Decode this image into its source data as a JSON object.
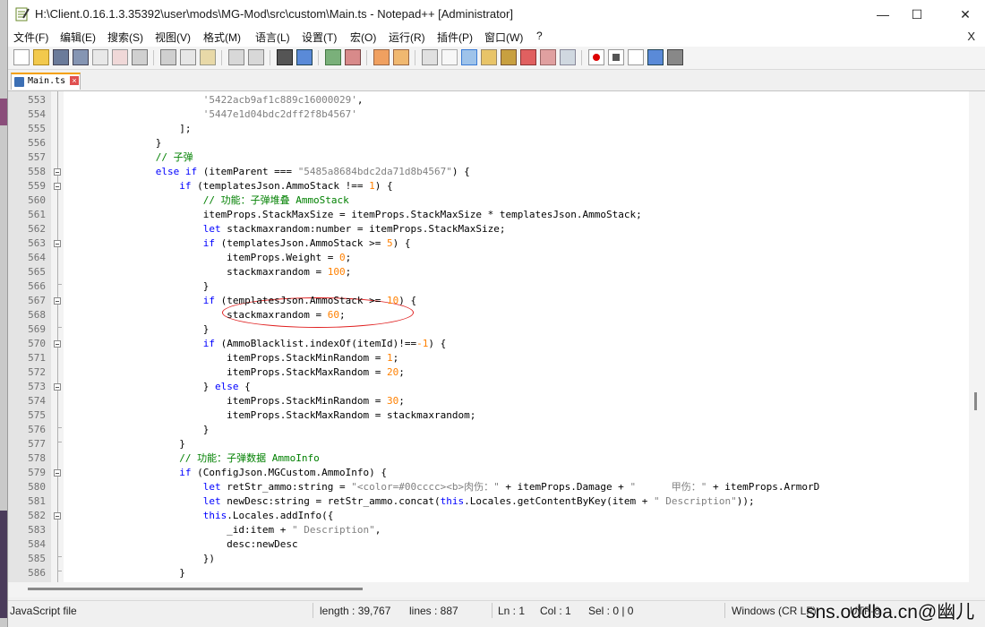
{
  "window": {
    "title": "H:\\Client.0.16.1.3.35392\\user\\mods\\MG-Mod\\src\\custom\\Main.ts - Notepad++ [Administrator]"
  },
  "title_buttons": {
    "minimize": "—",
    "maximize": "☐",
    "close": "✕"
  },
  "menu": [
    "文件(F)",
    "编辑(E)",
    "搜索(S)",
    "视图(V)",
    "格式(M)",
    "语言(L)",
    "设置(T)",
    "宏(O)",
    "运行(R)",
    "插件(P)",
    "窗口(W)",
    "?"
  ],
  "menu_close": "X",
  "tab": {
    "label": "Main.ts"
  },
  "editor": {
    "lines": [
      {
        "n": "553",
        "html": "                      <span class='s'>'5422acb9af1c889c16000029'</span>,"
      },
      {
        "n": "554",
        "html": "                      <span class='s'>'5447e1d04bdc2dff2f8b4567'</span>"
      },
      {
        "n": "555",
        "html": "                  ];"
      },
      {
        "n": "556",
        "html": "              }"
      },
      {
        "n": "557",
        "html": "              <span class='c'>// 子弹</span>"
      },
      {
        "n": "558",
        "html": "              <span class='k'>else</span> <span class='k'>if</span> (itemParent === <span class='s'>\"5485a8684bdc2da71d8b4567\"</span>) {"
      },
      {
        "n": "559",
        "html": "                  <span class='k'>if</span> (templatesJson.AmmoStack !== <span class='n'>1</span>) {"
      },
      {
        "n": "560",
        "html": "                      <span class='c'>// 功能：子弹堆叠 AmmoStack</span>"
      },
      {
        "n": "561",
        "html": "                      itemProps.StackMaxSize = itemProps.StackMaxSize * templatesJson.AmmoStack;"
      },
      {
        "n": "562",
        "html": "                      <span class='k'>let</span> stackmaxrandom:number = itemProps.StackMaxSize;"
      },
      {
        "n": "563",
        "html": "                      <span class='k'>if</span> (templatesJson.AmmoStack >= <span class='n'>5</span>) {"
      },
      {
        "n": "564",
        "html": "                          itemProps.Weight = <span class='n'>0</span>;"
      },
      {
        "n": "565",
        "html": "                          stackmaxrandom = <span class='n'>100</span>;"
      },
      {
        "n": "566",
        "html": "                      }"
      },
      {
        "n": "567",
        "html": "                      <span class='k'>if</span> (templatesJson.AmmoStack >= <span class='n'>10</span>) {"
      },
      {
        "n": "568",
        "html": "                          stackmaxrandom = <span class='n'>60</span>;"
      },
      {
        "n": "569",
        "html": "                      }"
      },
      {
        "n": "570",
        "html": "                      <span class='k'>if</span> (AmmoBlacklist.indexOf(itemId)!==<span class='n'>-1</span>) {"
      },
      {
        "n": "571",
        "html": "                          itemProps.StackMinRandom = <span class='n'>1</span>;"
      },
      {
        "n": "572",
        "html": "                          itemProps.StackMaxRandom = <span class='n'>20</span>;"
      },
      {
        "n": "573",
        "html": "                      } <span class='k'>else</span> {"
      },
      {
        "n": "574",
        "html": "                          itemProps.StackMinRandom = <span class='n'>30</span>;"
      },
      {
        "n": "575",
        "html": "                          itemProps.StackMaxRandom = stackmaxrandom;"
      },
      {
        "n": "576",
        "html": "                      }"
      },
      {
        "n": "577",
        "html": "                  }"
      },
      {
        "n": "578",
        "html": "                  <span class='c'>// 功能：子弹数据 AmmoInfo</span>"
      },
      {
        "n": "579",
        "html": "                  <span class='k'>if</span> (ConfigJson.MGCustom.AmmoInfo) {"
      },
      {
        "n": "580",
        "html": "                      <span class='k'>let</span> retStr_ammo:string = <span class='s'>\"&lt;color=#00cccc&gt;&lt;b&gt;肉伤：\"</span> + itemProps.Damage + <span class='s'>\"      甲伤：\"</span> + itemProps.ArmorD"
      },
      {
        "n": "581",
        "html": "                      <span class='k'>let</span> newDesc:string = retStr_ammo.concat(<span class='k'>this</span>.Locales.getContentByKey(item + <span class='s'>\" Description\"</span>));"
      },
      {
        "n": "582",
        "html": "                      <span class='k'>this</span>.Locales.addInfo({"
      },
      {
        "n": "583",
        "html": "                          _id:item + <span class='s'>\" Description\"</span>,"
      },
      {
        "n": "584",
        "html": "                          desc:newDesc"
      },
      {
        "n": "585",
        "html": "                      })"
      },
      {
        "n": "586",
        "html": "                  }"
      }
    ]
  },
  "status": {
    "file_type": "JavaScript file",
    "length": "length : 39,767",
    "lines": "lines : 887",
    "ln": "Ln : 1",
    "col": "Col : 1",
    "sel": "Sel : 0 | 0",
    "eol": "Windows (CR LF)",
    "enc": "UTF-8"
  },
  "watermark": "sns.oddba.cn@幽儿"
}
